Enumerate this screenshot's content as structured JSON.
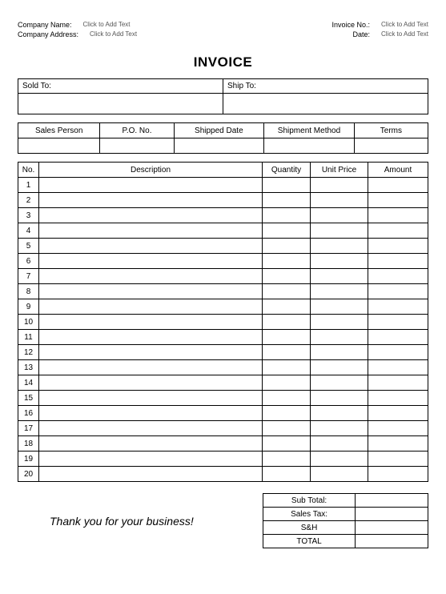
{
  "header": {
    "company_name_label": "Company Name:",
    "company_name_placeholder": "Click to Add Text",
    "company_address_label": "Company Address:",
    "company_address_placeholder": "Click to Add Text",
    "invoice_no_label": "Invoice No.:",
    "invoice_no_placeholder": "Click to Add Text",
    "date_label": "Date:",
    "date_placeholder": "Click to Add Text"
  },
  "title": "INVOICE",
  "soldship": {
    "sold_to_label": "Sold To:",
    "sold_to_value": "",
    "ship_to_label": "Ship To:",
    "ship_to_value": ""
  },
  "details": {
    "headers": [
      "Sales Person",
      "P.O. No.",
      "Shipped Date",
      "Shipment Method",
      "Terms"
    ],
    "values": [
      "",
      "",
      "",
      "",
      ""
    ]
  },
  "items": {
    "headers": {
      "no": "No.",
      "description": "Description",
      "quantity": "Quantity",
      "unit_price": "Unit Price",
      "amount": "Amount"
    },
    "rows": [
      {
        "no": "1",
        "description": "",
        "quantity": "",
        "unit_price": "",
        "amount": ""
      },
      {
        "no": "2",
        "description": "",
        "quantity": "",
        "unit_price": "",
        "amount": ""
      },
      {
        "no": "3",
        "description": "",
        "quantity": "",
        "unit_price": "",
        "amount": ""
      },
      {
        "no": "4",
        "description": "",
        "quantity": "",
        "unit_price": "",
        "amount": ""
      },
      {
        "no": "5",
        "description": "",
        "quantity": "",
        "unit_price": "",
        "amount": ""
      },
      {
        "no": "6",
        "description": "",
        "quantity": "",
        "unit_price": "",
        "amount": ""
      },
      {
        "no": "7",
        "description": "",
        "quantity": "",
        "unit_price": "",
        "amount": ""
      },
      {
        "no": "8",
        "description": "",
        "quantity": "",
        "unit_price": "",
        "amount": ""
      },
      {
        "no": "9",
        "description": "",
        "quantity": "",
        "unit_price": "",
        "amount": ""
      },
      {
        "no": "10",
        "description": "",
        "quantity": "",
        "unit_price": "",
        "amount": ""
      },
      {
        "no": "11",
        "description": "",
        "quantity": "",
        "unit_price": "",
        "amount": ""
      },
      {
        "no": "12",
        "description": "",
        "quantity": "",
        "unit_price": "",
        "amount": ""
      },
      {
        "no": "13",
        "description": "",
        "quantity": "",
        "unit_price": "",
        "amount": ""
      },
      {
        "no": "14",
        "description": "",
        "quantity": "",
        "unit_price": "",
        "amount": ""
      },
      {
        "no": "15",
        "description": "",
        "quantity": "",
        "unit_price": "",
        "amount": ""
      },
      {
        "no": "16",
        "description": "",
        "quantity": "",
        "unit_price": "",
        "amount": ""
      },
      {
        "no": "17",
        "description": "",
        "quantity": "",
        "unit_price": "",
        "amount": ""
      },
      {
        "no": "18",
        "description": "",
        "quantity": "",
        "unit_price": "",
        "amount": ""
      },
      {
        "no": "19",
        "description": "",
        "quantity": "",
        "unit_price": "",
        "amount": ""
      },
      {
        "no": "20",
        "description": "",
        "quantity": "",
        "unit_price": "",
        "amount": ""
      }
    ]
  },
  "totals": {
    "rows": [
      {
        "label": "Sub Total:",
        "value": ""
      },
      {
        "label": "Sales Tax:",
        "value": ""
      },
      {
        "label": "S&H",
        "value": ""
      },
      {
        "label": "TOTAL",
        "value": ""
      }
    ]
  },
  "thanks": "Thank you for your business!"
}
